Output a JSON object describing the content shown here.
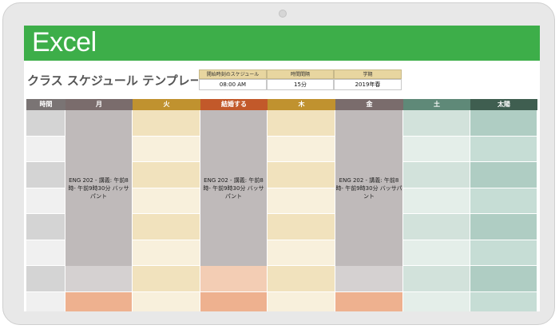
{
  "app": {
    "name": "Excel"
  },
  "sheet": {
    "title": "クラス スケジュール テンプレート",
    "settings": [
      {
        "label": "開始時刻のスケジュール",
        "value": "08:00 AM"
      },
      {
        "label": "時間間隔",
        "value": "15分"
      },
      {
        "label": "学期",
        "value": "2019年春"
      }
    ]
  },
  "columns": [
    {
      "label": "時間",
      "color": "#7a7474"
    },
    {
      "label": "月",
      "color": "#7a6c6c"
    },
    {
      "label": "火",
      "color": "#c0922f"
    },
    {
      "label": "結婚する",
      "color": "#c2592a"
    },
    {
      "label": "木",
      "color": "#c0922f"
    },
    {
      "label": "金",
      "color": "#7a6c6c"
    },
    {
      "label": "土",
      "color": "#5f8978"
    },
    {
      "label": "太陽",
      "color": "#3f5e50"
    }
  ],
  "classes": {
    "mon": "ENG 202 - 講義: 午前8時- 午前9時30分 バッサパント",
    "wed": "ENG 202 - 講義: 午前8時- 午前9時30分 バッサパント",
    "fri": "ENG 202 - 講義: 午前8時- 午前9時30分 バッサパント"
  }
}
